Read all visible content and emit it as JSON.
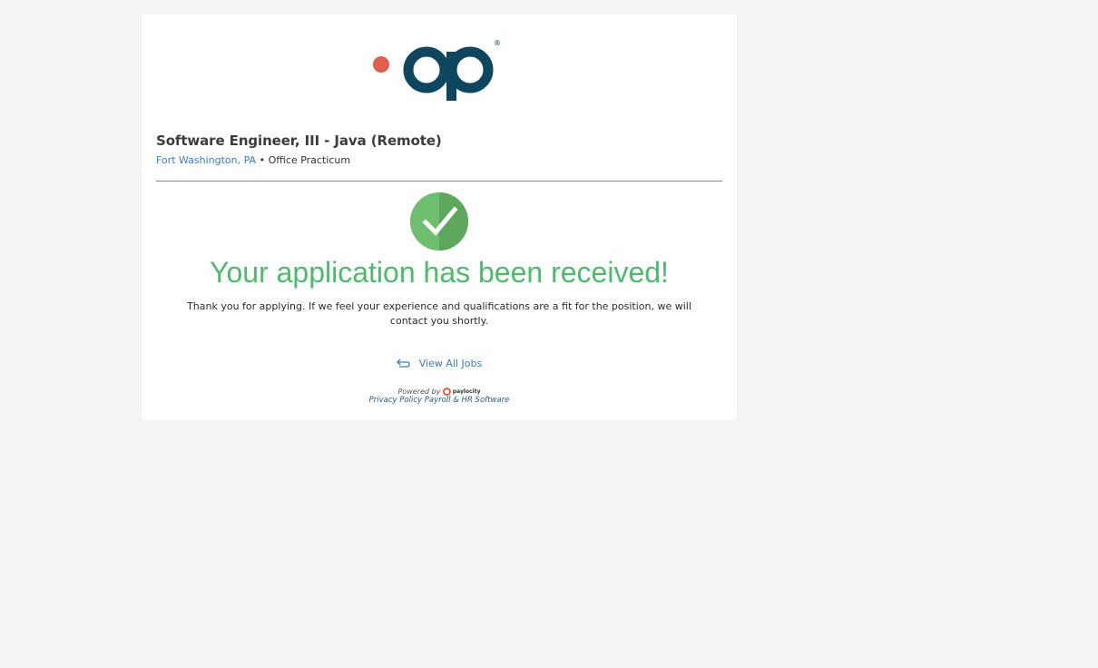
{
  "logo": {
    "name": "op-logo",
    "primary_color": "#0e4660",
    "accent_color": "#e0604a",
    "registered_mark": "®"
  },
  "job": {
    "title": "Software Engineer, III - Java (Remote)",
    "location": "Fort Washington, PA",
    "separator": "•",
    "company": "Office Practicum"
  },
  "confirmation": {
    "icon": "check-circle-icon",
    "icon_color": "#6fbe6f",
    "heading": "Your application has been received!",
    "message": "Thank you for applying. If we feel your experience and qualifications are a fit for the position, we will contact you shortly."
  },
  "actions": {
    "view_all_jobs_icon": "return-arrow-icon",
    "view_all_jobs_label": "View All Jobs"
  },
  "footer": {
    "powered_by": "Powered by",
    "brand_name": "paylocity",
    "brand_color": "#e8502f",
    "privacy_policy": "Privacy Policy",
    "payroll_link": "Payroll & HR Software"
  },
  "colors": {
    "background": "#f4f4f4",
    "card": "#ffffff",
    "link": "#3a7cc4",
    "success": "#4cbb6c"
  }
}
